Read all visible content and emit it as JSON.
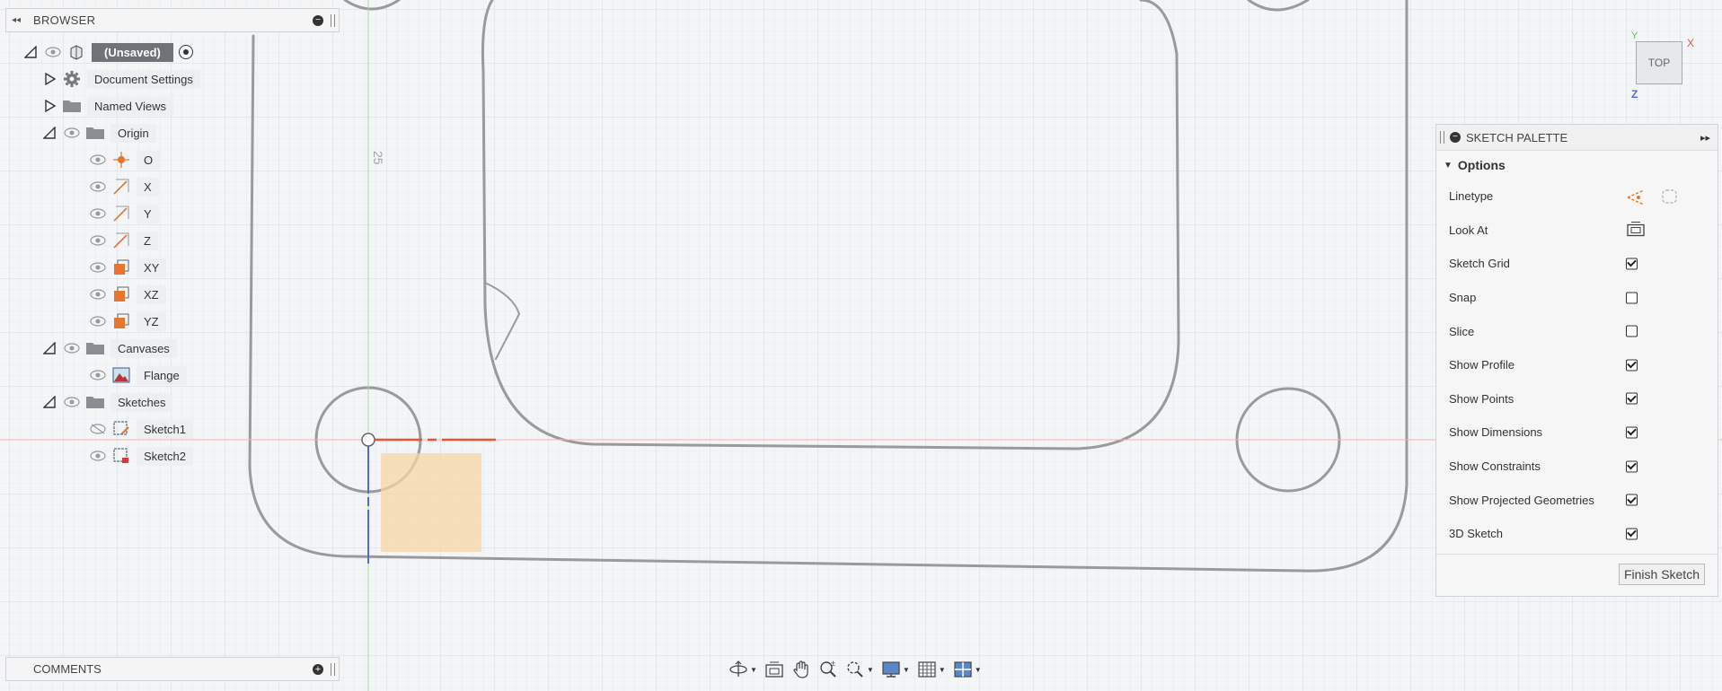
{
  "browser": {
    "title": "BROWSER",
    "root_label": "(Unsaved)",
    "items": [
      {
        "label": "Document Settings",
        "icon": "gear-icon"
      },
      {
        "label": "Named Views",
        "icon": "folder-icon"
      },
      {
        "label": "Origin",
        "icon": "folder-icon"
      },
      {
        "label": "O",
        "icon": "origin-point-icon"
      },
      {
        "label": "X",
        "icon": "axis-icon"
      },
      {
        "label": "Y",
        "icon": "axis-icon"
      },
      {
        "label": "Z",
        "icon": "axis-icon"
      },
      {
        "label": "XY",
        "icon": "plane-icon"
      },
      {
        "label": "XZ",
        "icon": "plane-icon"
      },
      {
        "label": "YZ",
        "icon": "plane-icon"
      },
      {
        "label": "Canvases",
        "icon": "folder-icon"
      },
      {
        "label": "Flange",
        "icon": "canvas-image-icon"
      },
      {
        "label": "Sketches",
        "icon": "folder-icon"
      },
      {
        "label": "Sketch1",
        "icon": "sketch-icon"
      },
      {
        "label": "Sketch2",
        "icon": "sketch-icon"
      }
    ]
  },
  "comments": {
    "title": "COMMENTS"
  },
  "viewport": {
    "dimension_label": "25"
  },
  "viewcube": {
    "face_label": "TOP",
    "x_label": "X",
    "y_label": "Y",
    "z_label": "Z"
  },
  "palette": {
    "title": "SKETCH PALETTE",
    "section_title": "Options",
    "rows": [
      {
        "label": "Linetype",
        "control": "icons"
      },
      {
        "label": "Look At",
        "control": "button"
      },
      {
        "label": "Sketch Grid",
        "checked": true
      },
      {
        "label": "Snap",
        "checked": false
      },
      {
        "label": "Slice",
        "checked": false
      },
      {
        "label": "Show Profile",
        "checked": true
      },
      {
        "label": "Show Points",
        "checked": true
      },
      {
        "label": "Show Dimensions",
        "checked": true
      },
      {
        "label": "Show Constraints",
        "checked": true
      },
      {
        "label": "Show Projected Geometries",
        "checked": true
      },
      {
        "label": "3D Sketch",
        "checked": true
      }
    ],
    "finish_label": "Finish Sketch"
  },
  "toolbar": {
    "items": [
      "orbit-icon",
      "look-at-icon",
      "pan-icon",
      "zoom-icon",
      "fit-icon",
      "display-settings-icon",
      "grid-settings-icon",
      "viewports-icon"
    ]
  },
  "colors": {
    "accent": "#e8752f",
    "axis_red": "#e65a4a",
    "axis_green": "#5bbf4b",
    "axis_blue": "#4a6fd8"
  }
}
